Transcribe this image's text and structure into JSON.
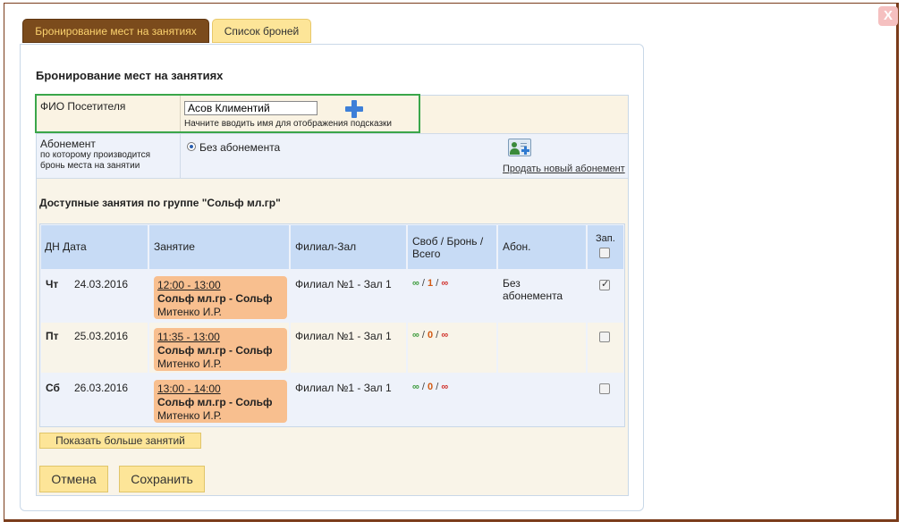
{
  "close_label": "X",
  "tabs": [
    {
      "label": "Бронирование мест на занятиях",
      "active": true
    },
    {
      "label": "Список броней",
      "active": false
    }
  ],
  "form": {
    "title": "Бронирование мест на занятиях",
    "fio_label": "ФИО Посетителя",
    "fio_value": "Асов Климентий",
    "fio_hint": "Начните вводить имя для отображения подсказки",
    "abon_label": "Абонемент",
    "abon_sub1": "по которому производится",
    "abon_sub2": "бронь места на занятии",
    "abon_option": "Без абонемента",
    "sell_link": "Продать новый абонемент"
  },
  "lessons_section": {
    "title": "Доступные занятия по группе \"Сольф мл.гр\"",
    "headers": {
      "day_date": "ДН Дата",
      "lesson": "Занятие",
      "branch": "Филиал-Зал",
      "free1": "Своб / Бронь /",
      "free2": "Всего",
      "abon": "Абон.",
      "reserve": "Зап."
    },
    "rows": [
      {
        "day": "Чт",
        "date": "24.03.2016",
        "time": "12:00 - 13:00",
        "name": "Сольф мл.гр - Сольф",
        "teacher": "Митенко И.Р.",
        "branch": "Филиал №1 - Зал 1",
        "free": "∞",
        "booked": "1",
        "total": "∞",
        "abon1": "Без",
        "abon2": "абонемента",
        "checked": true
      },
      {
        "day": "Пт",
        "date": "25.03.2016",
        "time": "11:35 - 13:00",
        "name": "Сольф мл.гр - Сольф",
        "teacher": "Митенко И.Р.",
        "branch": "Филиал №1 - Зал 1",
        "free": "∞",
        "booked": "0",
        "total": "∞",
        "abon1": "",
        "abon2": "",
        "checked": false
      },
      {
        "day": "Сб",
        "date": "26.03.2016",
        "time": "13:00 - 14:00",
        "name": "Сольф мл.гр - Сольф",
        "teacher": "Митенко И.Р.",
        "branch": "Филиал №1 - Зал 1",
        "free": "∞",
        "booked": "0",
        "total": "∞",
        "abon1": "",
        "abon2": "",
        "checked": false
      }
    ],
    "more_button": "Показать больше занятий"
  },
  "buttons": {
    "cancel": "Отмена",
    "save": "Сохранить"
  }
}
